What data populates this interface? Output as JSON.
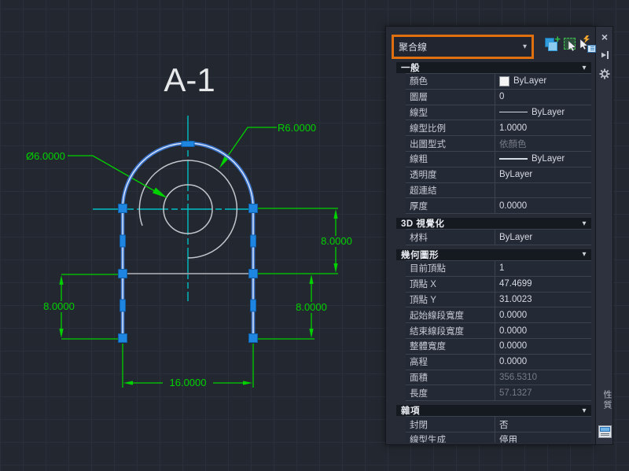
{
  "canvas": {
    "title": "A-1",
    "dimensions": {
      "radius_label": "R6.0000",
      "diameter_label": "Ø6.0000",
      "right_upper": "8.0000",
      "right_lower": "8.0000",
      "left": "8.0000",
      "bottom": "16.0000"
    },
    "colors": {
      "background": "#232830",
      "grid": "#2a303b",
      "dimension_green": "#00d200",
      "centerline_cyan": "#00bfc6",
      "selection_blue": "#3d74cc",
      "grip_blue": "#1e86e0",
      "geometry_gray": "#c2c6cc"
    }
  },
  "palette": {
    "selector": {
      "value": "聚合線",
      "chevron_icon": "chevron-down-icon"
    },
    "toolbar": {
      "pickadd_icon": "pickadd-toggle-icon",
      "select_objects_icon": "select-objects-icon",
      "quick_select_icon": "quick-select-icon"
    },
    "titlebar": {
      "close_icon": "close-icon",
      "autohide_icon": "auto-hide-icon",
      "settings_icon": "gear-icon",
      "tab_label": "性質",
      "palette_icon": "properties-palette-icon"
    },
    "sections": [
      {
        "title": "一般",
        "rows": [
          {
            "label": "顏色",
            "value": "ByLayer"
          },
          {
            "label": "圖層",
            "value": "0"
          },
          {
            "label": "線型",
            "value": "ByLayer"
          },
          {
            "label": "線型比例",
            "value": "1.0000"
          },
          {
            "label": "出圖型式",
            "value": "依顏色"
          },
          {
            "label": "線粗",
            "value": "ByLayer"
          },
          {
            "label": "透明度",
            "value": "ByLayer"
          },
          {
            "label": "超連結",
            "value": ""
          },
          {
            "label": "厚度",
            "value": "0.0000"
          }
        ]
      },
      {
        "title": "3D 視覺化",
        "rows": [
          {
            "label": "材料",
            "value": "ByLayer"
          }
        ]
      },
      {
        "title": "幾何圖形",
        "rows": [
          {
            "label": "目前頂點",
            "value": "1"
          },
          {
            "label": "頂點 X",
            "value": "47.4699"
          },
          {
            "label": "頂點 Y",
            "value": "31.0023"
          },
          {
            "label": "起始線段寬度",
            "value": "0.0000"
          },
          {
            "label": "結束線段寬度",
            "value": "0.0000"
          },
          {
            "label": "整體寬度",
            "value": "0.0000"
          },
          {
            "label": "高程",
            "value": "0.0000"
          },
          {
            "label": "面積",
            "value": "356.5310"
          },
          {
            "label": "長度",
            "value": "57.1327"
          }
        ]
      },
      {
        "title": "雜項",
        "rows": [
          {
            "label": "封閉",
            "value": "否"
          },
          {
            "label": "線型生成",
            "value": "停用"
          }
        ]
      }
    ]
  }
}
